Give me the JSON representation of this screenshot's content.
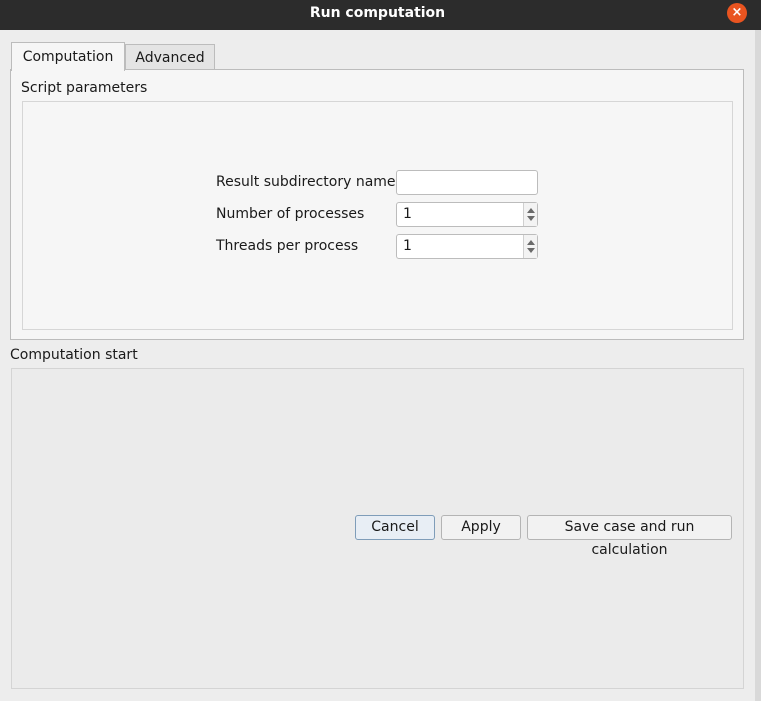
{
  "window": {
    "title": "Run computation",
    "close_symbol": "×"
  },
  "tabs": [
    {
      "label": "Computation",
      "active": true
    },
    {
      "label": "Advanced",
      "active": false
    }
  ],
  "script_parameters": {
    "label": "Script parameters",
    "fields": {
      "result_subdir": {
        "label": "Result subdirectory name",
        "value": ""
      },
      "num_processes": {
        "label": "Number of processes",
        "value": "1"
      },
      "threads_per_process": {
        "label": "Threads per process",
        "value": "1"
      }
    }
  },
  "computation_start": {
    "label": "Computation start",
    "buttons": {
      "cancel": "Cancel",
      "apply": "Apply",
      "save_run": "Save case and run calculation"
    }
  },
  "colors": {
    "titlebar": "#2c2c2c",
    "close": "#e95420",
    "focus": "#7f9db9"
  }
}
